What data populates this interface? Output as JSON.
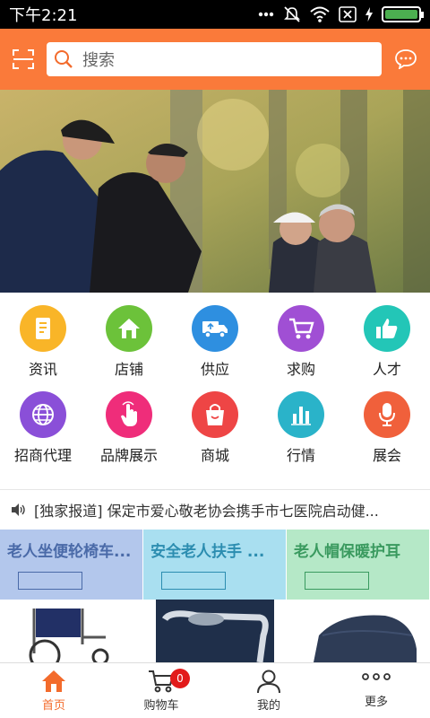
{
  "status_bar": {
    "time": "下午2:21",
    "icons": [
      "more-dots-icon",
      "mute-icon",
      "wifi-icon",
      "sim-x-icon",
      "charging-icon",
      "battery-icon"
    ],
    "battery_level": 1.0
  },
  "search": {
    "placeholder": "搜索",
    "scan_icon": "scan-icon",
    "message_icon": "message-icon"
  },
  "banner": {
    "image": "elderly-men-playing-chess-outdoors"
  },
  "categories": [
    {
      "label": "资讯",
      "icon": "document-icon",
      "color": "#f9b528"
    },
    {
      "label": "店铺",
      "icon": "home-icon",
      "color": "#6cc23a"
    },
    {
      "label": "供应",
      "icon": "truck-icon",
      "color": "#2e8fe0"
    },
    {
      "label": "求购",
      "icon": "cart-icon",
      "color": "#a04fd4"
    },
    {
      "label": "人才",
      "icon": "thumbs-up-icon",
      "color": "#23c6b7"
    },
    {
      "label": "招商代理",
      "icon": "globe-icon",
      "color": "#8a4fd8"
    },
    {
      "label": "品牌展示",
      "icon": "hand-tap-icon",
      "color": "#ef2d7a"
    },
    {
      "label": "商城",
      "icon": "shopping-bag-icon",
      "color": "#ee4545"
    },
    {
      "label": "行情",
      "icon": "bar-chart-icon",
      "color": "#2ab3c9"
    },
    {
      "label": "展会",
      "icon": "microphone-icon",
      "color": "#f0603b"
    }
  ],
  "news": {
    "icon": "speaker-icon",
    "text": "[独家报道] 保定市爱心敬老协会携手市七医院启动健..."
  },
  "products": [
    {
      "title": "老人坐便轮椅车...",
      "bg": "#b3c7ec",
      "title_color": "#4a6aa8",
      "box_color": "#4a6aa8",
      "image": "wheelchair"
    },
    {
      "title": "安全老人扶手 ...",
      "bg": "#a9dff0",
      "title_color": "#2c8db0",
      "box_color": "#2c8db0",
      "image": "grab-bar"
    },
    {
      "title": "老人帽保暖护耳",
      "bg": "#b5e8c7",
      "title_color": "#3a9a5f",
      "box_color": "#3a9a5f",
      "image": "winter-hat"
    }
  ],
  "bottom_nav": [
    {
      "label": "首页",
      "icon": "home-icon",
      "active": true
    },
    {
      "label": "购物车",
      "icon": "cart-icon",
      "active": false,
      "badge": "0"
    },
    {
      "label": "我的",
      "icon": "user-icon",
      "active": false
    },
    {
      "label": "更多",
      "icon": "more-dots-icon",
      "active": false
    }
  ],
  "colors": {
    "brand_orange": "#fa7a3a",
    "nav_active": "#f36b2c"
  }
}
